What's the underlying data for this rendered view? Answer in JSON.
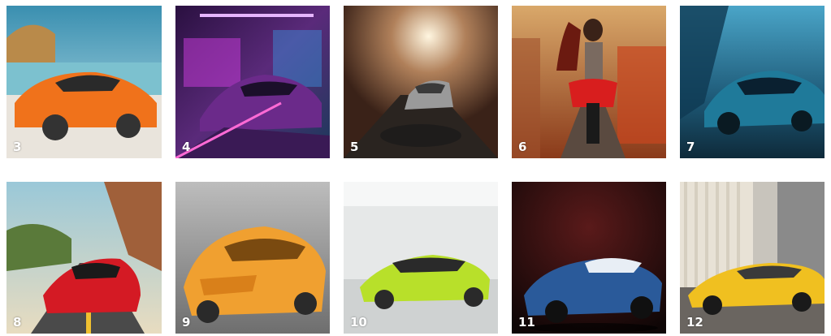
{
  "gallery": {
    "tiles": [
      {
        "label": "3",
        "subject": "orange sports car by the sea"
      },
      {
        "label": "4",
        "subject": "purple sports car in neon garage"
      },
      {
        "label": "5",
        "subject": "silver car in tunnel"
      },
      {
        "label": "6",
        "subject": "rider on red motorcycle"
      },
      {
        "label": "7",
        "subject": "teal sports car on highway"
      },
      {
        "label": "8",
        "subject": "red sports car on coastal road"
      },
      {
        "label": "9",
        "subject": "orange concept car in garage"
      },
      {
        "label": "10",
        "subject": "lime green car in white garage"
      },
      {
        "label": "11",
        "subject": "blue roadster on dark background"
      },
      {
        "label": "12",
        "subject": "yellow sports car in showroom"
      }
    ]
  },
  "colors": {
    "background": "#ffffff",
    "label_text": "#ffffff"
  }
}
